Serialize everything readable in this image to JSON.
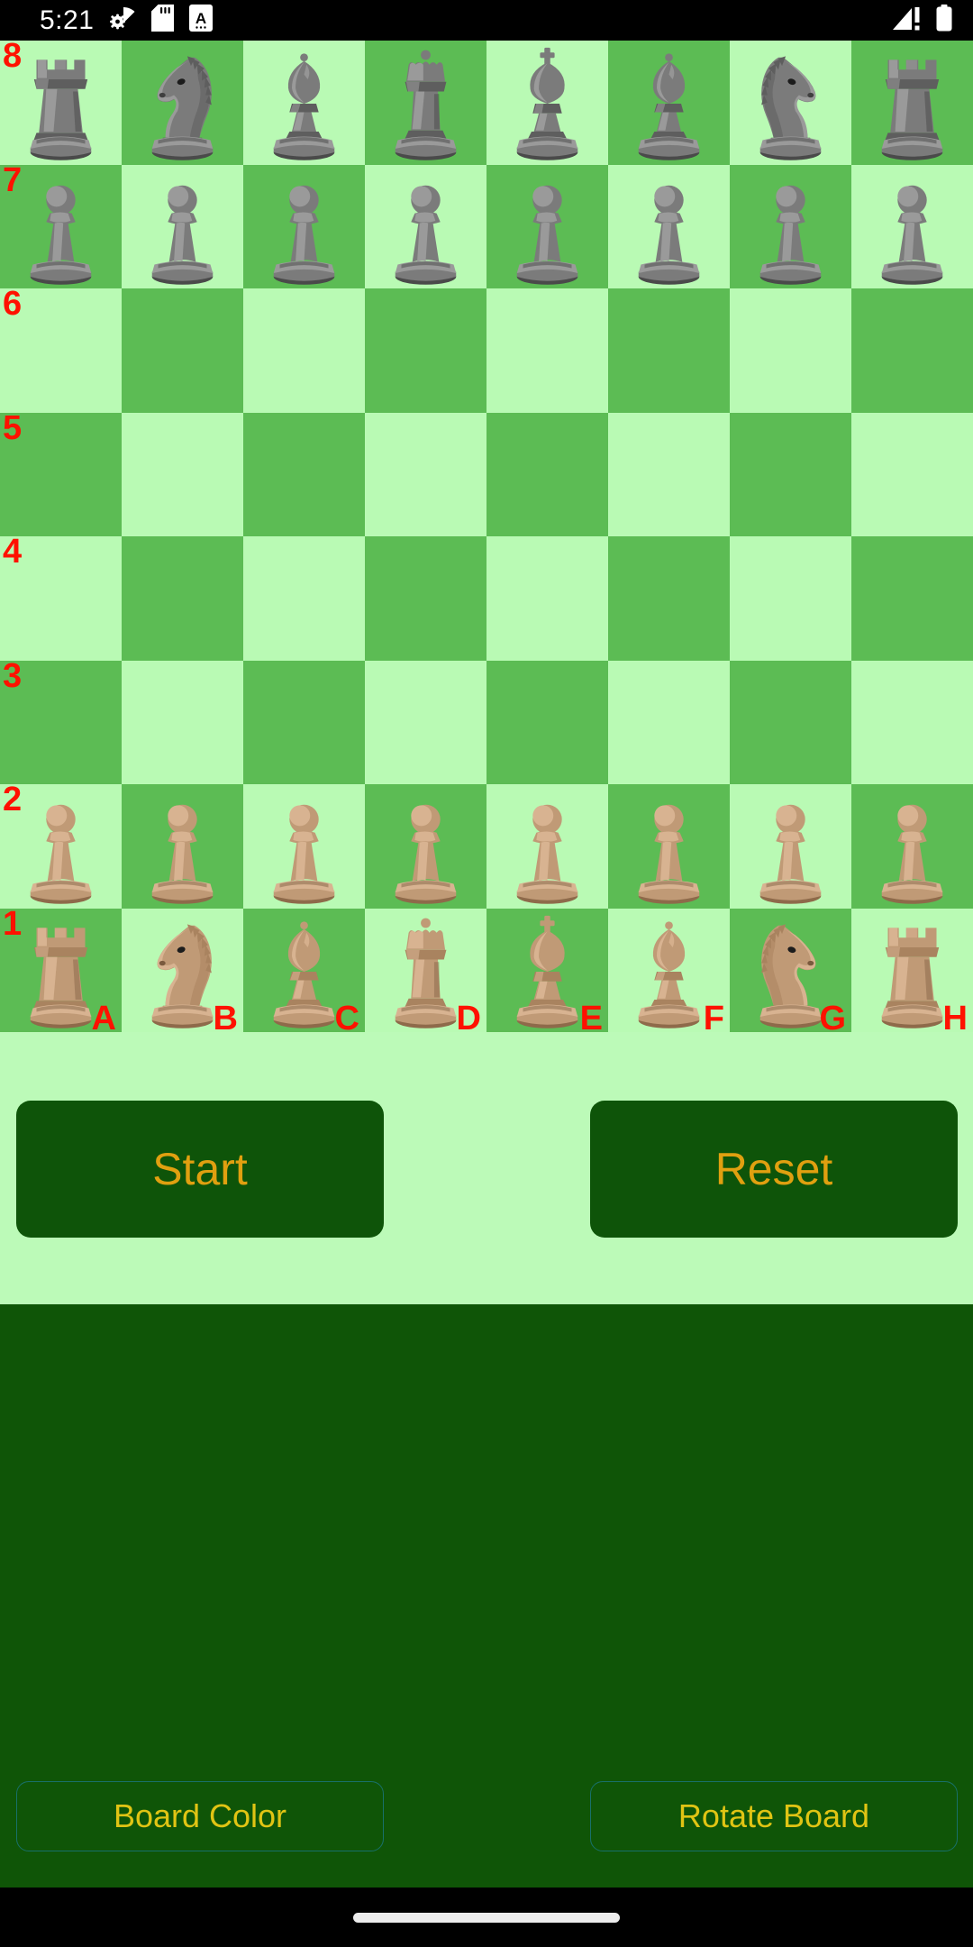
{
  "statusbar": {
    "time": "5:21",
    "left_icons": [
      "settings-wifi-icon",
      "sd-card-icon",
      "letter-a-badge-icon"
    ],
    "right_icons": [
      "cellular-no-sim-icon",
      "battery-full-icon"
    ]
  },
  "board": {
    "light_square_color": "#b9fab4",
    "dark_square_color": "#5cbc54",
    "label_color": "#ff1100",
    "rank_labels": [
      "8",
      "7",
      "6",
      "5",
      "4",
      "3",
      "2",
      "1"
    ],
    "file_labels": [
      "A",
      "B",
      "C",
      "D",
      "E",
      "F",
      "G",
      "H"
    ],
    "orientation": "white-bottom",
    "position": [
      [
        "br",
        "bn",
        "bb",
        "bq",
        "bk",
        "bb",
        "bn",
        "br"
      ],
      [
        "bp",
        "bp",
        "bp",
        "bp",
        "bp",
        "bp",
        "bp",
        "bp"
      ],
      [
        "",
        "",
        "",
        "",
        "",
        "",
        "",
        ""
      ],
      [
        "",
        "",
        "",
        "",
        "",
        "",
        "",
        ""
      ],
      [
        "",
        "",
        "",
        "",
        "",
        "",
        "",
        ""
      ],
      [
        "",
        "",
        "",
        "",
        "",
        "",
        "",
        ""
      ],
      [
        "wp",
        "wp",
        "wp",
        "wp",
        "wp",
        "wp",
        "wp",
        "wp"
      ],
      [
        "wr",
        "wn",
        "wb",
        "wq",
        "wk",
        "wb",
        "wn",
        "wr"
      ]
    ],
    "piece_names": {
      "br": "black-rook",
      "bn": "black-knight",
      "bb": "black-bishop",
      "bq": "black-queen",
      "bk": "black-king",
      "bp": "black-pawn",
      "wr": "white-rook",
      "wn": "white-knight",
      "wb": "white-bishop",
      "wq": "white-queen",
      "wk": "white-king",
      "wp": "white-pawn"
    }
  },
  "controls": {
    "start_label": "Start",
    "reset_label": "Reset",
    "board_color_label": "Board Color",
    "rotate_board_label": "Rotate Board",
    "primary_bg": "#0e5409",
    "primary_text_color": "#e0a010",
    "outline_text_color": "#e0c414",
    "panel_bg": "#bcfab8",
    "bottom_bg": "#0f5507"
  }
}
